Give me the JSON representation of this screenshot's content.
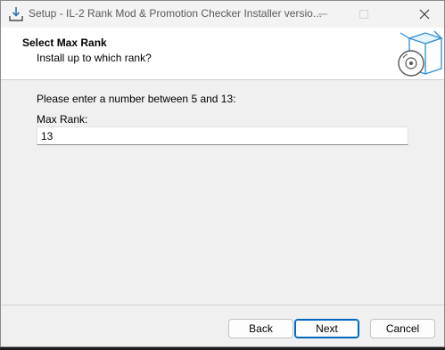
{
  "window": {
    "title": "Setup - IL-2 Rank Mod & Promotion Checker Installer versio..."
  },
  "header": {
    "title": "Select Max Rank",
    "subtitle": "Install up to which rank?"
  },
  "content": {
    "prompt": "Please enter a number between 5 and 13:",
    "field_label": "Max Rank:",
    "field_value": "13"
  },
  "footer": {
    "back_label": "Back",
    "next_label": "Next",
    "cancel_label": "Cancel"
  },
  "icons": {
    "app": "installer-download-icon",
    "header_art": "box-with-disc-icon"
  },
  "colors": {
    "accent": "#0067c0",
    "header_bg": "#ffffff",
    "body_bg": "#f0f0f0"
  }
}
